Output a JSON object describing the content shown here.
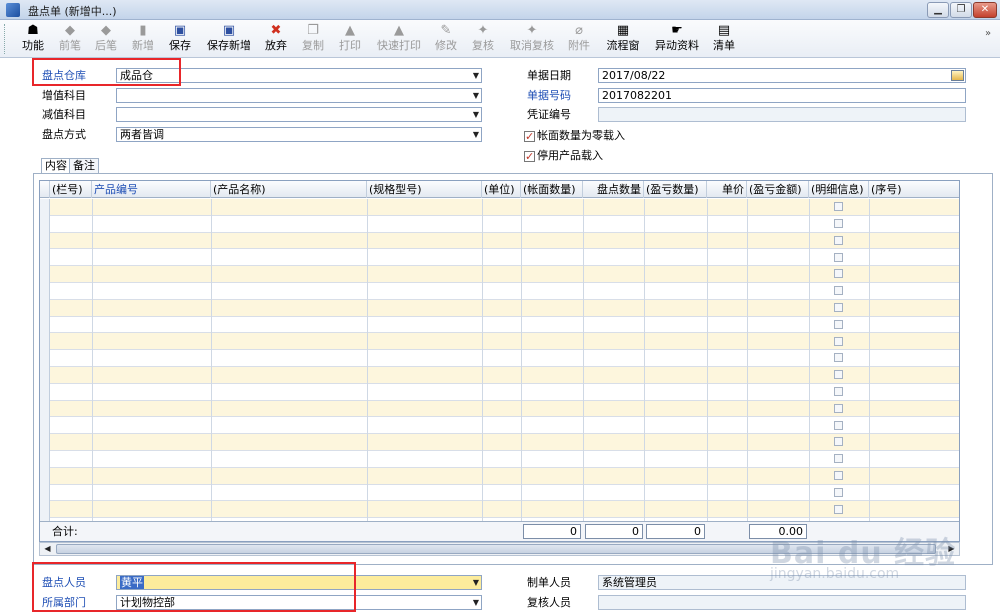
{
  "window": {
    "title": "盘点单 (新增中...)",
    "min": "▁",
    "max": "❐",
    "close": "✕"
  },
  "toolbar": [
    {
      "label": "功能",
      "icon": "function-icon",
      "glyph": "☗",
      "enabled": true
    },
    {
      "label": "前笔",
      "icon": "previous-icon",
      "glyph": "◆",
      "enabled": false
    },
    {
      "label": "后笔",
      "icon": "next-icon",
      "glyph": "◆",
      "enabled": false
    },
    {
      "label": "新增",
      "icon": "new-icon",
      "glyph": "▮",
      "enabled": false
    },
    {
      "label": "保存",
      "icon": "save-icon",
      "glyph": "▣",
      "enabled": true
    },
    {
      "label": "保存新增",
      "icon": "save-new-icon",
      "glyph": "▣",
      "enabled": true
    },
    {
      "label": "放弃",
      "icon": "discard-icon",
      "glyph": "✖",
      "enabled": true
    },
    {
      "label": "复制",
      "icon": "copy-icon",
      "glyph": "❐",
      "enabled": false
    },
    {
      "label": "打印",
      "icon": "print-icon",
      "glyph": "▲",
      "enabled": false
    },
    {
      "label": "快速打印",
      "icon": "quick-print-icon",
      "glyph": "▲",
      "enabled": false
    },
    {
      "label": "修改",
      "icon": "edit-icon",
      "glyph": "✎",
      "enabled": false
    },
    {
      "label": "复核",
      "icon": "review-icon",
      "glyph": "✦",
      "enabled": false
    },
    {
      "label": "取消复核",
      "icon": "cancel-review-icon",
      "glyph": "✦",
      "enabled": false
    },
    {
      "label": "附件",
      "icon": "attachment-icon",
      "glyph": "⌀",
      "enabled": false
    },
    {
      "label": "流程窗",
      "icon": "flow-window-icon",
      "glyph": "▦",
      "enabled": true
    },
    {
      "label": "异动资料",
      "icon": "change-data-icon",
      "glyph": "☛",
      "enabled": true
    },
    {
      "label": "清单",
      "icon": "list-icon",
      "glyph": "▤",
      "enabled": true
    }
  ],
  "form": {
    "warehouse_label": "盘点仓库",
    "warehouse_value": "成品仓",
    "increase_label": "增值科目",
    "increase_value": "",
    "decrease_label": "减值科目",
    "decrease_value": "",
    "method_label": "盘点方式",
    "method_value": "两者皆调",
    "date_label": "单据日期",
    "date_value": "2017/08/22",
    "docno_label": "单据号码",
    "docno_value": "2017082201",
    "voucher_label": "凭证编号",
    "voucher_value": "",
    "zero_load_label": "帐面数量为零载入",
    "zero_load_checked": true,
    "disabled_product_label": "停用产品载入",
    "disabled_product_checked": true
  },
  "tabs": [
    "内容",
    "备注"
  ],
  "grid": {
    "columns": [
      "(栏号)",
      "产品编号",
      "(产品名称)",
      "(规格型号)",
      "(单位)",
      "(帐面数量)",
      "盘点数量",
      "(盈亏数量)",
      "单价",
      "(盈亏金额)",
      "(明细信息)",
      "(序号)"
    ],
    "total_label": "合计:",
    "totals": {
      "book_qty": "0",
      "count_qty": "0",
      "diff_qty": "0",
      "diff_amount": "0.00"
    }
  },
  "footer": {
    "counter_label": "盘点人员",
    "counter_value": "黄平",
    "dept_label": "所属部门",
    "dept_value": "计划物控部",
    "maker_label": "制单人员",
    "maker_value": "系统管理员",
    "reviewer_label": "复核人员",
    "reviewer_value": ""
  },
  "watermark": {
    "text": "Bai du 经验",
    "sub": "jingyan.baidu.com"
  }
}
